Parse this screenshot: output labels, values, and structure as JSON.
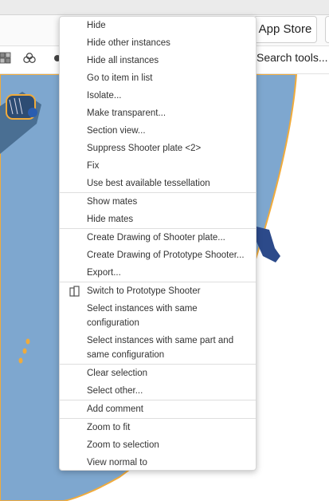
{
  "header": {
    "app_store_label": "App Store",
    "search_tools_label": "Search tools..."
  },
  "context_menu": {
    "items": [
      {
        "label": "Hide"
      },
      {
        "label": "Hide other instances"
      },
      {
        "label": "Hide all instances"
      },
      {
        "label": "Go to item in list"
      },
      {
        "label": "Isolate..."
      },
      {
        "label": "Make transparent..."
      },
      {
        "label": "Section view..."
      },
      {
        "label": "Suppress Shooter plate <2>"
      },
      {
        "label": "Fix"
      },
      {
        "label": "Use best available tessellation"
      },
      {
        "label": "Show mates"
      },
      {
        "label": "Hide mates"
      },
      {
        "label": "Create Drawing of Shooter plate..."
      },
      {
        "label": "Create Drawing of Prototype Shooter..."
      },
      {
        "label": "Export..."
      },
      {
        "label": "Switch to Prototype Shooter",
        "icon": "assembly-icon"
      },
      {
        "label": "Select instances with same configuration"
      },
      {
        "label": "Select instances with same part and same configuration"
      },
      {
        "label": "Clear selection"
      },
      {
        "label": "Select other..."
      },
      {
        "label": "Add comment"
      },
      {
        "label": "Zoom to fit"
      },
      {
        "label": "Zoom to selection"
      },
      {
        "label": "View normal to"
      }
    ]
  },
  "colors": {
    "plate_fill": "#7ea7cf",
    "selection_outline": "#f0ab3c",
    "menu_background": "#ffffff",
    "menu_text": "#333333"
  }
}
